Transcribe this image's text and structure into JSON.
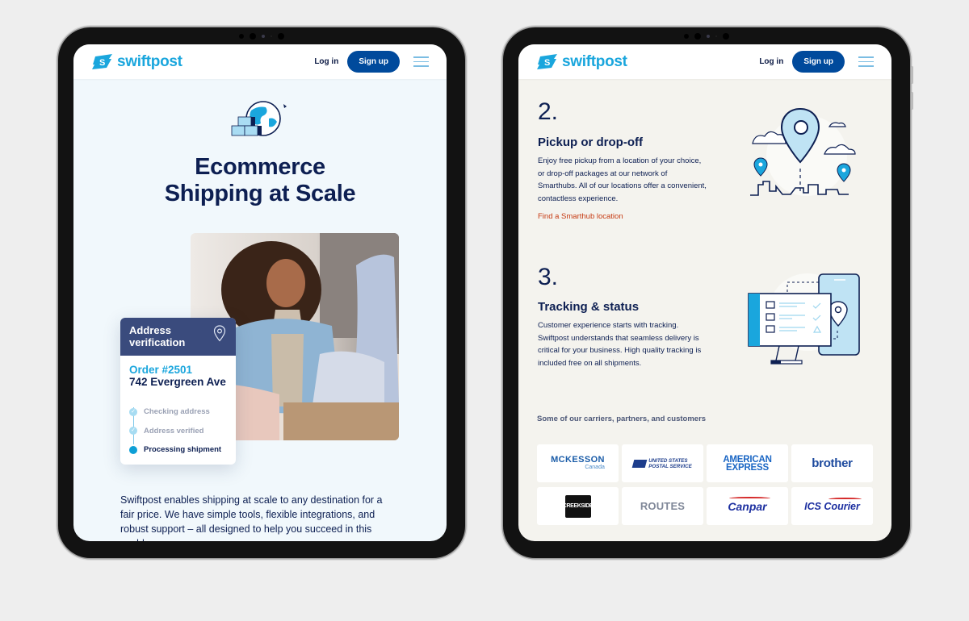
{
  "brand": {
    "name": "swiftpost",
    "primary_color": "#1aa6dd",
    "navy_color": "#0d1f52",
    "button_color": "#004a9c",
    "link_color": "#c63a12"
  },
  "nav": {
    "login_label": "Log in",
    "signup_label": "Sign up",
    "menu_icon": "hamburger-icon"
  },
  "left_screen": {
    "hero_icon": "globe-boxes-icon",
    "hero_title_line1": "Ecommerce",
    "hero_title_line2": "Shipping at Scale",
    "photo_alt": "Woman smiling while unpacking a blue sweater from a cardboard box",
    "address_card": {
      "title_line1": "Address",
      "title_line2": "verification",
      "icon": "location-pin-icon",
      "order_number": "Order #2501",
      "address": "742 Evergreen Ave",
      "steps": [
        {
          "label": "Checking address",
          "status": "done"
        },
        {
          "label": "Address verified",
          "status": "done"
        },
        {
          "label": "Processing shipment",
          "status": "active"
        }
      ]
    },
    "intro_text": "Swiftpost enables shipping at scale to any destination for a fair price. We have simple tools, flexible integrations, and robust support – all designed to help you succeed in this world."
  },
  "right_screen": {
    "features": [
      {
        "number": "2.",
        "title": "Pickup or drop-off",
        "text": "Enjoy free pickup from a location of your choice, or drop-off packages at our network of Smarthubs. All of our locations offer a convenient, contactless experience.",
        "link": "Find a Smarthub location",
        "illustration": "city-map-pins-icon"
      },
      {
        "number": "3.",
        "title": "Tracking & status",
        "text": "Customer experience starts with tracking. Swiftpost understands that seamless delivery is critical for your business. High quality tracking is included free on all shipments.",
        "illustration": "monitor-phone-tracking-icon"
      }
    ],
    "partners_label": "Some of our carriers, partners, and customers",
    "partners": [
      {
        "name": "McKesson Canada",
        "line1": "MCKESSON",
        "line2": "Canada"
      },
      {
        "name": "United States Postal Service",
        "line1": "UNITED STATES",
        "line2": "POSTAL SERVICE"
      },
      {
        "name": "American Express",
        "line1": "AMERICAN",
        "line2": "EXPRESS"
      },
      {
        "name": "Brother",
        "line1": "brother"
      },
      {
        "name": "Creekside",
        "line1": "CREEKSIDE"
      },
      {
        "name": "Routes",
        "line1": "ROUTES"
      },
      {
        "name": "Canpar Express",
        "line1": "Canpar"
      },
      {
        "name": "ICS Courier",
        "line1": "ICS Courier"
      }
    ]
  }
}
